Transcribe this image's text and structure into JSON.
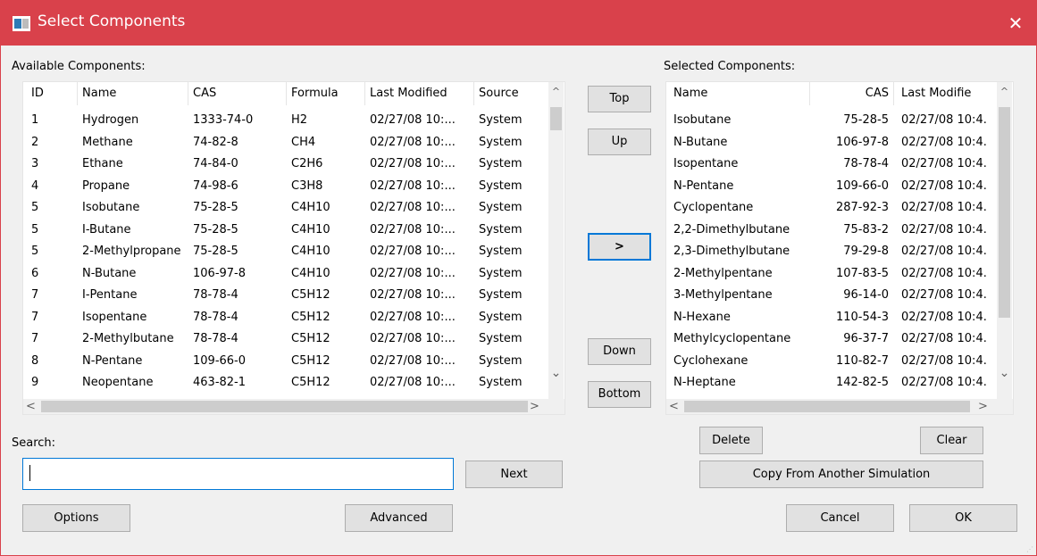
{
  "window": {
    "title": "Select Components",
    "close": "✕"
  },
  "available": {
    "label": "Available Components:",
    "columns": [
      "ID",
      "Name",
      "CAS",
      "Formula",
      "Last Modified",
      "Source"
    ],
    "rows": [
      [
        "1",
        "Hydrogen",
        "1333-74-0",
        "H2",
        "02/27/08 10:...",
        "System"
      ],
      [
        "2",
        "Methane",
        "74-82-8",
        "CH4",
        "02/27/08 10:...",
        "System"
      ],
      [
        "3",
        "Ethane",
        "74-84-0",
        "C2H6",
        "02/27/08 10:...",
        "System"
      ],
      [
        "4",
        "Propane",
        "74-98-6",
        "C3H8",
        "02/27/08 10:...",
        "System"
      ],
      [
        "5",
        "Isobutane",
        "75-28-5",
        "C4H10",
        "02/27/08 10:...",
        "System"
      ],
      [
        "5",
        "I-Butane",
        "75-28-5",
        "C4H10",
        "02/27/08 10:...",
        "System"
      ],
      [
        "5",
        "2-Methylpropane",
        "75-28-5",
        "C4H10",
        "02/27/08 10:...",
        "System"
      ],
      [
        "6",
        "N-Butane",
        "106-97-8",
        "C4H10",
        "02/27/08 10:...",
        "System"
      ],
      [
        "7",
        "I-Pentane",
        "78-78-4",
        "C5H12",
        "02/27/08 10:...",
        "System"
      ],
      [
        "7",
        "Isopentane",
        "78-78-4",
        "C5H12",
        "02/27/08 10:...",
        "System"
      ],
      [
        "7",
        "2-Methylbutane",
        "78-78-4",
        "C5H12",
        "02/27/08 10:...",
        "System"
      ],
      [
        "8",
        "N-Pentane",
        "109-66-0",
        "C5H12",
        "02/27/08 10:...",
        "System"
      ],
      [
        "9",
        "Neopentane",
        "463-82-1",
        "C5H12",
        "02/27/08 10:...",
        "System"
      ]
    ]
  },
  "selected": {
    "label": "Selected Components:",
    "columns": [
      "Name",
      "CAS",
      "Last Modifie"
    ],
    "rows": [
      [
        "Isobutane",
        "75-28-5",
        "02/27/08 10:4."
      ],
      [
        "N-Butane",
        "106-97-8",
        "02/27/08 10:4."
      ],
      [
        "Isopentane",
        "78-78-4",
        "02/27/08 10:4."
      ],
      [
        "N-Pentane",
        "109-66-0",
        "02/27/08 10:4."
      ],
      [
        "Cyclopentane",
        "287-92-3",
        "02/27/08 10:4."
      ],
      [
        "2,2-Dimethylbutane",
        "75-83-2",
        "02/27/08 10:4."
      ],
      [
        "2,3-Dimethylbutane",
        "79-29-8",
        "02/27/08 10:4."
      ],
      [
        "2-Methylpentane",
        "107-83-5",
        "02/27/08 10:4."
      ],
      [
        "3-Methylpentane",
        "96-14-0",
        "02/27/08 10:4."
      ],
      [
        "N-Hexane",
        "110-54-3",
        "02/27/08 10:4."
      ],
      [
        "Methylcyclopentane",
        "96-37-7",
        "02/27/08 10:4."
      ],
      [
        "Cyclohexane",
        "110-82-7",
        "02/27/08 10:4."
      ],
      [
        "N-Heptane",
        "142-82-5",
        "02/27/08 10:4."
      ]
    ]
  },
  "order_buttons": {
    "top": "Top",
    "up": "Up",
    "add": ">",
    "down": "Down",
    "bottom": "Bottom"
  },
  "search": {
    "label": "Search:",
    "value": "",
    "next": "Next"
  },
  "footer": {
    "options": "Options",
    "advanced": "Advanced",
    "delete": "Delete",
    "clear": "Clear",
    "copy": "Copy From Another Simulation",
    "cancel": "Cancel",
    "ok": "OK"
  },
  "icons": {
    "scroll_up": "^",
    "scroll_down": "⌄",
    "scroll_left": "<",
    "scroll_right": ">"
  },
  "colors": {
    "titlebar": "#d9414b",
    "focus": "#0078d7"
  }
}
